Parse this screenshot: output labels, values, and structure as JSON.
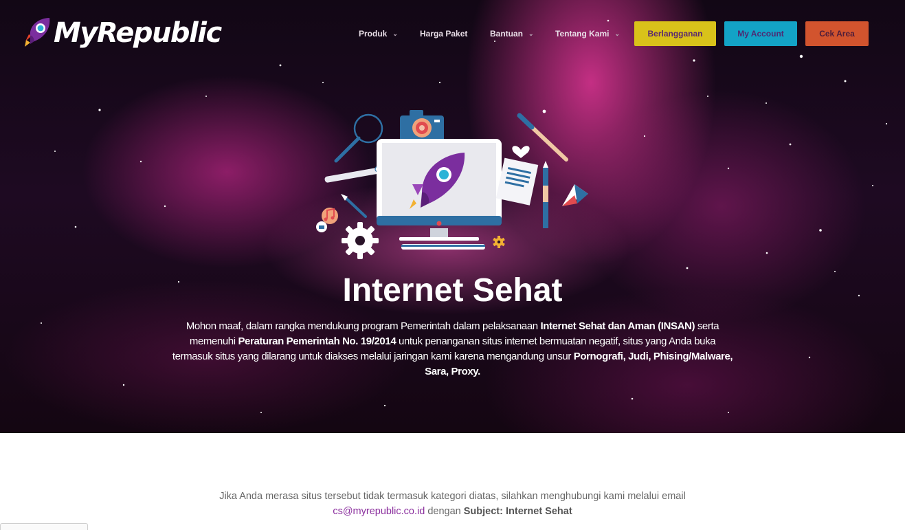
{
  "brand": {
    "name": "MyRepublic"
  },
  "nav": {
    "items": [
      {
        "label": "Produk",
        "has_dropdown": true
      },
      {
        "label": "Harga Paket",
        "has_dropdown": false
      },
      {
        "label": "Bantuan",
        "has_dropdown": true
      },
      {
        "label": "Tentang Kami",
        "has_dropdown": true
      }
    ],
    "buttons": {
      "subscribe": "Berlangganan",
      "account": "My Account",
      "check_area": "Cek Area"
    }
  },
  "hero": {
    "title": "Internet Sehat",
    "desc": {
      "p1": "Mohon maaf, dalam rangka mendukung program Pemerintah dalam pelaksanaan ",
      "b1": "Internet Sehat dan Aman (INSAN)",
      "p2": " serta memenuhi ",
      "b2": "Peraturan Pemerintah No. 19/2014",
      "p3": " untuk penanganan situs internet bermuatan negatif, situs yang Anda buka termasuk situs yang dilarang untuk diakses melalui jaringan kami karena mengandung unsur ",
      "b3": "Pornografi, Judi, Phising/Malware, Sara, Proxy."
    }
  },
  "info": {
    "line1": "Jika Anda merasa situs tersebut tidak termasuk kategori diatas, silahkan menghubungi kami melalui email",
    "email": "cs@myrepublic.co.id",
    "connector": " dengan ",
    "subject": "Subject: Internet Sehat"
  },
  "colors": {
    "subscribe_bg": "#d9c21a",
    "account_bg": "#13a3c6",
    "check_area_bg": "#d2542e",
    "link": "#8a2e9d",
    "brand_purple": "#7b2e9e"
  },
  "icons": [
    "rocket-icon",
    "chevron-down-icon",
    "magnifier-icon",
    "camera-icon",
    "monitor-icon",
    "gear-icon",
    "music-note-icon",
    "thumbs-up-icon",
    "pen-nib-icon",
    "heart-icon",
    "document-icon",
    "paintbrush-icon",
    "pencil-icon",
    "paper-plane-icon"
  ]
}
